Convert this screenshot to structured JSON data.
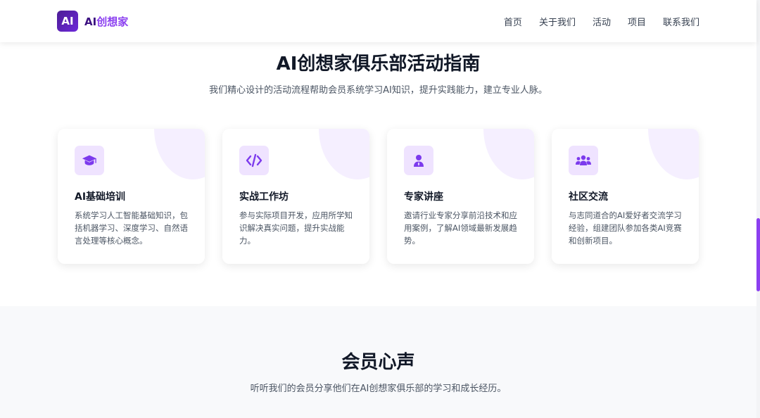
{
  "header": {
    "logo_badge": "AI",
    "logo_text_prefix": "AI",
    "logo_text_rest": "创想家",
    "nav": [
      "首页",
      "关于我们",
      "活动",
      "项目",
      "联系我们"
    ]
  },
  "activities": {
    "title": "AI创想家俱乐部活动指南",
    "subtitle": "我们精心设计的活动流程帮助会员系统学习AI知识，提升实践能力，建立专业人脉。",
    "cards": [
      {
        "icon": "graduation-cap-icon",
        "title": "AI基础培训",
        "desc": "系统学习人工智能基础知识，包括机器学习、深度学习、自然语言处理等核心概念。"
      },
      {
        "icon": "code-icon",
        "title": "实战工作坊",
        "desc": "参与实际项目开发，应用所学知识解决真实问题，提升实战能力。"
      },
      {
        "icon": "presenter-icon",
        "title": "专家讲座",
        "desc": "邀请行业专家分享前沿技术和应用案例，了解AI领域最新发展趋势。"
      },
      {
        "icon": "community-icon",
        "title": "社区交流",
        "desc": "与志同道合的AI爱好者交流学习经验，组建团队参加各类AI竞赛和创新项目。"
      }
    ]
  },
  "testimonials": {
    "title": "会员心声",
    "subtitle": "听听我们的会员分享他们在AI创想家俱乐部的学习和成长经历。"
  },
  "colors": {
    "accent": "#8b3ff0",
    "brand_dark": "#4c1d95",
    "icon_bg": "#efe3ff"
  }
}
